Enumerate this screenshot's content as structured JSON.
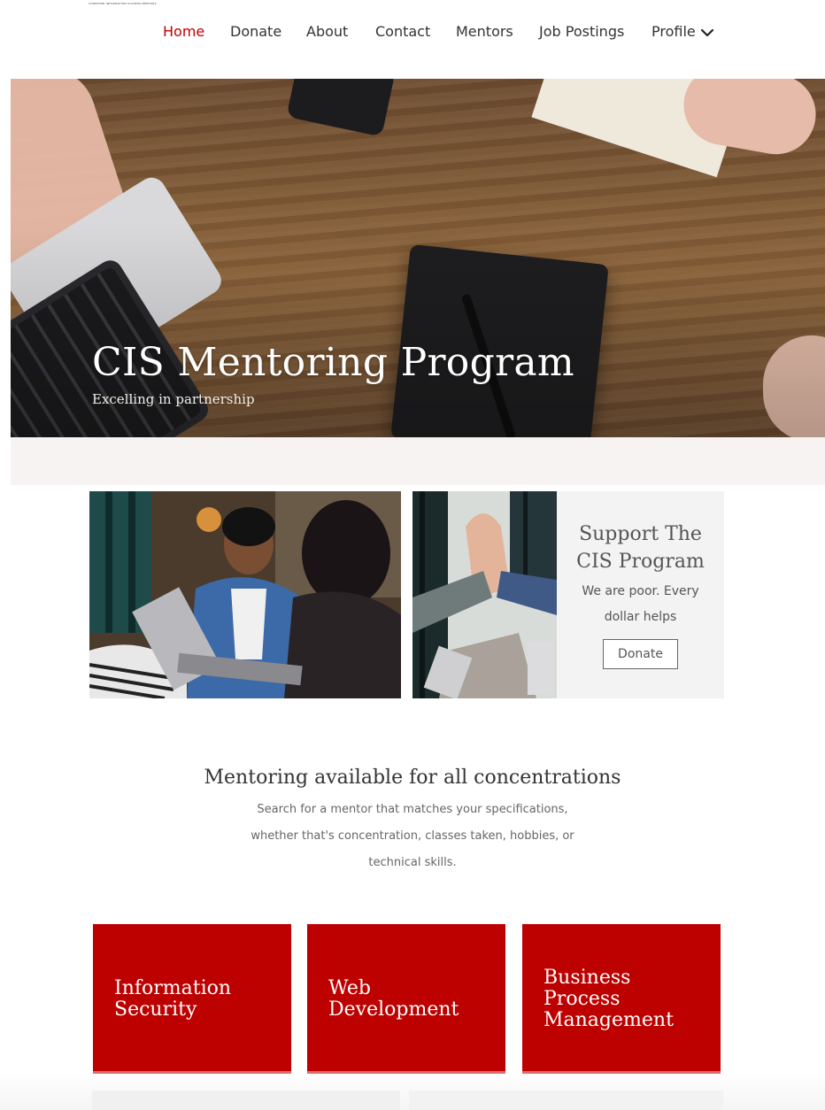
{
  "logo": {
    "text": "COMPUTER INFORMATION SYSTEMS MENTORS"
  },
  "nav": {
    "items": [
      {
        "label": "Home"
      },
      {
        "label": "Donate"
      },
      {
        "label": "About"
      },
      {
        "label": "Contact"
      },
      {
        "label": "Mentors"
      },
      {
        "label": "Job Postings"
      },
      {
        "label": "Profile"
      }
    ]
  },
  "hero": {
    "title": "CIS Mentoring Program",
    "subtitle": "Excelling in partnership"
  },
  "support": {
    "title": "Support The CIS Program",
    "text": "We are poor. Every dollar helps",
    "button_label": "Donate"
  },
  "mentoring": {
    "title": "Mentoring available for all concentrations",
    "text": "Search for a mentor that matches your specifications, whether that's concentration, classes taken, hobbies, or technical skills."
  },
  "tiles": [
    {
      "label": "Information\nSecurity"
    },
    {
      "label": "Web\nDevelopment"
    },
    {
      "label": "Business\nProcess\nManagement"
    }
  ],
  "colors": {
    "accent": "#c00000",
    "tile_bg": "#bd0000"
  }
}
